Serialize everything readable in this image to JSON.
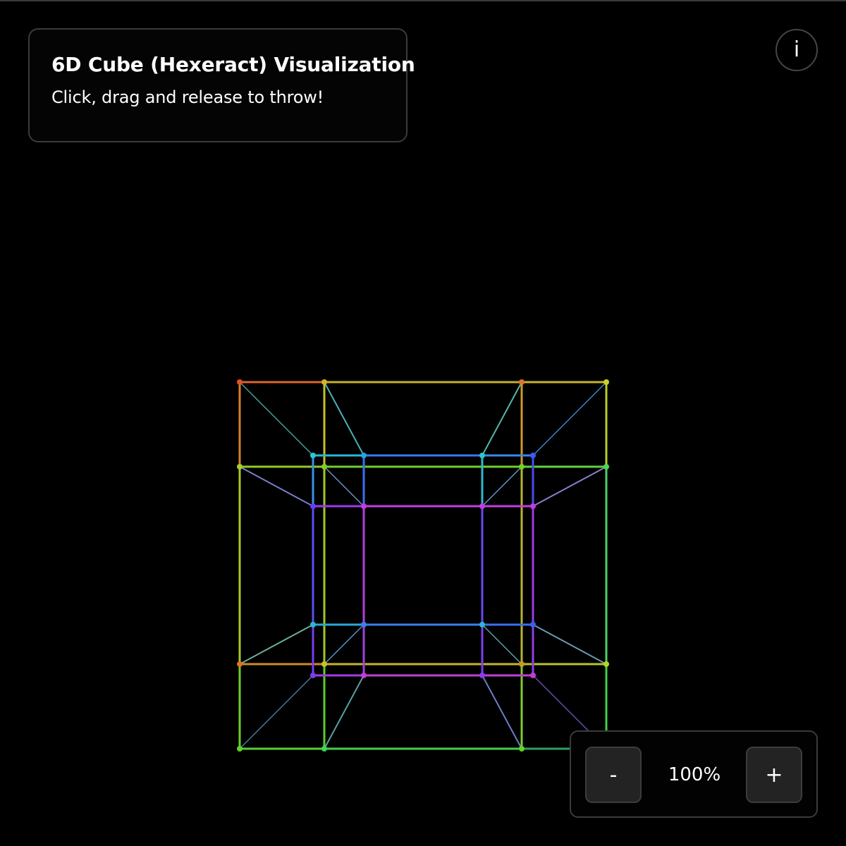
{
  "info_panel": {
    "title": "6D Cube (Hexeract) Visualization",
    "subtitle": "Click, drag and release to throw!"
  },
  "info_button": {
    "label": "i"
  },
  "zoom": {
    "decrease_label": "-",
    "level": "100%",
    "increase_label": "+"
  },
  "colors": {
    "background": "#000000",
    "panel_border": "#3b3b3b",
    "button_fill": "#232323",
    "text": "#ffffff"
  },
  "visualization": {
    "object": "hexeract wireframe",
    "edge_colors": [
      "#e0502a",
      "#c8b42a",
      "#9ccc2a",
      "#4ed24a",
      "#2ad0c8",
      "#3a6cf0",
      "#8a3cf0",
      "#d23cd2"
    ]
  }
}
